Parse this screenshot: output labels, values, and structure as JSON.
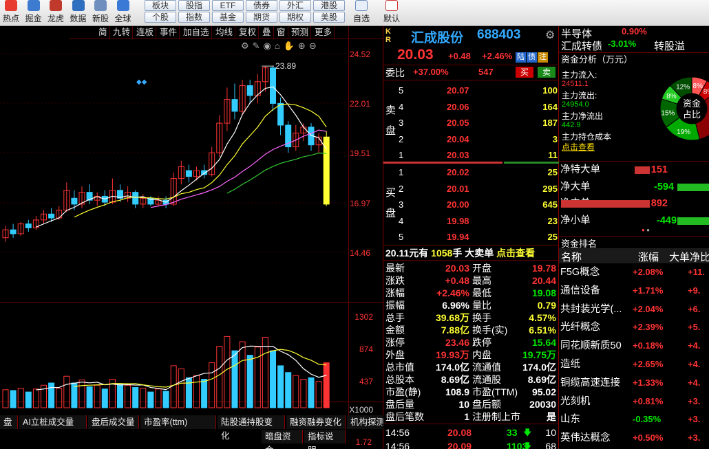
{
  "toolbar": {
    "icons": [
      {
        "label": "热点",
        "icon": "hot-icon",
        "color": "#e83b2f"
      },
      {
        "label": "掘金",
        "icon": "dig-icon",
        "color": "#3d7bd0"
      },
      {
        "label": "龙虎",
        "icon": "dragon-icon",
        "color": "#c0392b"
      },
      {
        "label": "数据",
        "icon": "pe-icon",
        "color": "#2e6fbf"
      },
      {
        "label": "新股",
        "icon": "ipo-icon",
        "color": "#6f8fbf"
      },
      {
        "label": "全球",
        "icon": "globe-icon",
        "color": "#3a7ad6"
      }
    ],
    "row1": [
      "板块",
      "股指",
      "ETF",
      "债券",
      "外汇",
      "港股"
    ],
    "row2": [
      "个股",
      "指数",
      "基金",
      "期货",
      "期权",
      "美股"
    ],
    "right_icons": [
      {
        "label": "自选",
        "icon": "edit-icon"
      },
      {
        "label": "默认",
        "icon": "home-icon"
      }
    ]
  },
  "chart": {
    "tools": [
      "简",
      "九转",
      "连板",
      "事件",
      "加自选",
      "均线",
      "复权",
      "叠",
      "窗",
      "预测",
      "更多"
    ],
    "prev_close_label": "23.89",
    "price_labels": [
      "24.52",
      "22.01",
      "19.51",
      "16.97",
      "14.46"
    ],
    "vol_labels": [
      "1302",
      "874",
      "437",
      "X1000"
    ],
    "sub_labels": [
      "1.72"
    ],
    "bottom_tabs": [
      "盘",
      "AI立桩成交量",
      "盘后成交量",
      "市盈率(ttm)",
      "陆股通持股变化",
      "融资融券变化",
      "机构探测器"
    ],
    "bottom_tabs2": [
      "暗盘资金",
      "指标说明"
    ]
  },
  "quote": {
    "name": "汇成股份",
    "code": "688403",
    "market_tag": "K R",
    "price": "20.03",
    "change": "+0.48",
    "change_pct": "+2.46%",
    "tags": [
      "陆",
      "债",
      "注"
    ],
    "webi_label": "委比",
    "webi": "+37.00%",
    "weicha": "547",
    "buy_btn": "买",
    "sell_btn": "卖",
    "sell_label": "卖盘",
    "buy_label": "买盘",
    "asks": [
      {
        "lv": "5",
        "p": "20.07",
        "v": "100"
      },
      {
        "lv": "4",
        "p": "20.06",
        "v": "164"
      },
      {
        "lv": "3",
        "p": "20.05",
        "v": "187"
      },
      {
        "lv": "2",
        "p": "20.04",
        "v": "3"
      },
      {
        "lv": "1",
        "p": "20.03",
        "v": "11"
      }
    ],
    "bids": [
      {
        "lv": "1",
        "p": "20.02",
        "v": "25"
      },
      {
        "lv": "2",
        "p": "20.01",
        "v": "295"
      },
      {
        "lv": "3",
        "p": "20.00",
        "v": "645"
      },
      {
        "lv": "4",
        "p": "19.98",
        "v": "23"
      },
      {
        "lv": "5",
        "p": "19.94",
        "v": "25"
      }
    ],
    "bigdeal": {
      "a": "20.11",
      "a_unit": "元有",
      "b": "1058",
      "b_unit": "手",
      "c": "大卖单",
      "d": "点击查看"
    },
    "stats": [
      [
        "最新",
        "20.03",
        "开盘",
        "19.78"
      ],
      [
        "涨跌",
        "+0.48",
        "最高",
        "20.44"
      ],
      [
        "涨幅",
        "+2.46%",
        "最低",
        "19.08"
      ],
      [
        "振幅",
        "6.96%",
        "量比",
        "0.79"
      ],
      [
        "总手",
        "39.68万",
        "换手",
        "4.57%"
      ],
      [
        "金额",
        "7.88亿",
        "换手(实)",
        "6.51%"
      ],
      [
        "涨停",
        "23.46",
        "跌停",
        "15.64"
      ],
      [
        "外盘",
        "19.93万",
        "内盘",
        "19.75万"
      ],
      [
        "总市值",
        "174.0亿",
        "流通值",
        "174.0亿"
      ],
      [
        "总股本",
        "8.69亿",
        "流通股",
        "8.69亿"
      ],
      [
        "市盈(静)",
        "108.9",
        "市盈(TTM)",
        "95.02"
      ],
      [
        "盘后量",
        "10",
        "盘后额",
        "20030"
      ],
      [
        "盘后笔数",
        "1",
        "注册制上市",
        "是"
      ]
    ],
    "ticks": [
      {
        "t": "14:56",
        "p": "20.08",
        "v": "33",
        "n": "10"
      },
      {
        "t": "14:56",
        "p": "20.09",
        "v": "1103",
        "n": "68"
      }
    ]
  },
  "right": {
    "top": [
      {
        "name": "半导体",
        "pct": "0.90%"
      },
      {
        "name": "汇成转债",
        "pct": "-3.01%",
        "extra": "转股溢"
      }
    ],
    "fund_title": "资金分析（万元）",
    "fund": [
      {
        "k": "主力流入:",
        "v": "24511.1"
      },
      {
        "k": "主力流出:",
        "v": "24954.0"
      },
      {
        "k": "主力净流出",
        "v": "442.9"
      },
      {
        "k": "主力持仓成本",
        "v": ""
      }
    ],
    "fund_link": "点击查看",
    "donut_center": [
      "资金",
      "占比"
    ],
    "donut": [
      {
        "label": "8%",
        "value": 8,
        "color": "#ff5555"
      },
      {
        "label": "8%",
        "value": 8,
        "color": "#cc0000"
      },
      {
        "label": "",
        "value": 30,
        "color": "#8b0000"
      },
      {
        "label": "19%",
        "value": 19,
        "color": "#00aa00"
      },
      {
        "label": "15%",
        "value": 15,
        "color": "#006600"
      },
      {
        "label": "8%",
        "value": 8,
        "color": "#22cc22"
      },
      {
        "label": "12%",
        "value": 12,
        "color": "#004d00"
      }
    ],
    "flows": [
      {
        "name": "净特大单",
        "v": "151",
        "value": 151,
        "color": "#cc3333"
      },
      {
        "name": "净大单",
        "v": "-594",
        "value": -594,
        "color": "#22bb22"
      },
      {
        "name": "净中单",
        "v": "892",
        "value": 892,
        "color": "#cc3333"
      },
      {
        "name": "净小单",
        "v": "-449",
        "value": -449,
        "color": "#22bb22"
      }
    ],
    "rank_title": "资金排名",
    "rank_headers": [
      "名称",
      "涨幅",
      "大单净比"
    ],
    "rank": [
      {
        "name": "F5G概念",
        "pct": "+2.08%",
        "v": "+11."
      },
      {
        "name": "通信设备",
        "pct": "+1.71%",
        "v": "+9."
      },
      {
        "name": "共封装光学(...",
        "pct": "+2.04%",
        "v": "+6."
      },
      {
        "name": "光纤概念",
        "pct": "+2.39%",
        "v": "+5."
      },
      {
        "name": "同花顺新质50",
        "pct": "+0.18%",
        "v": "+4."
      },
      {
        "name": "造纸",
        "pct": "+2.65%",
        "v": "+4."
      },
      {
        "name": "铜缆高速连接",
        "pct": "+1.33%",
        "v": "+4."
      },
      {
        "name": "光刻机",
        "pct": "+0.81%",
        "v": "+3."
      },
      {
        "name": "山东",
        "pct": "-0.35%",
        "v": "+3."
      },
      {
        "name": "英伟达概念",
        "pct": "+0.50%",
        "v": "+3."
      }
    ]
  }
}
